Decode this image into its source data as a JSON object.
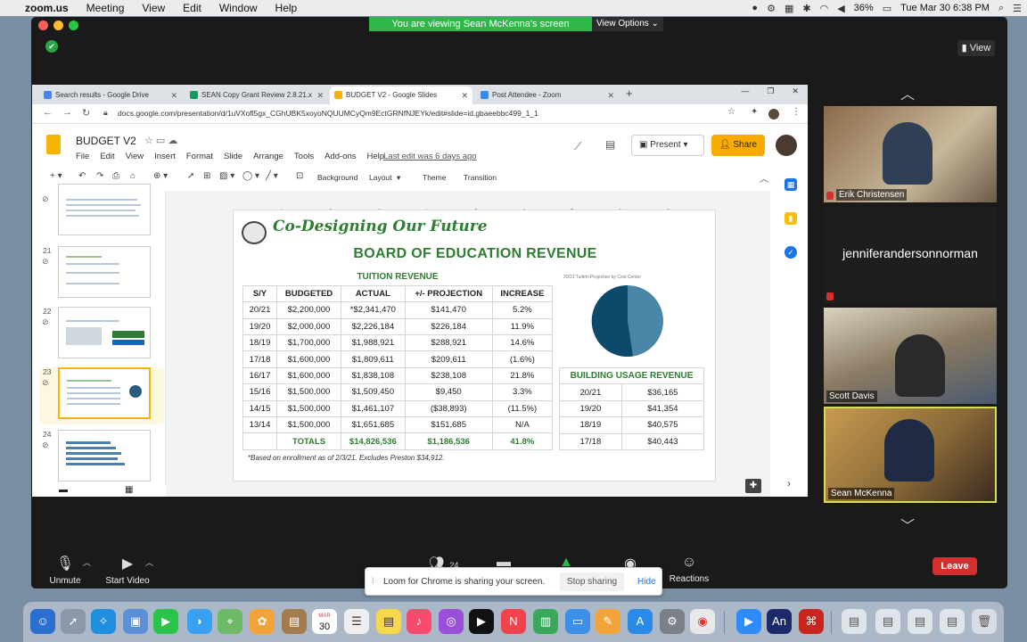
{
  "menubar": {
    "app_name": "zoom.us",
    "items": [
      "Meeting",
      "View",
      "Edit",
      "Window",
      "Help"
    ],
    "battery": "36%",
    "datetime": "Tue Mar 30  6:38 PM"
  },
  "zoom": {
    "viewing_banner": "You are viewing Sean McKenna's screen",
    "view_options": "View Options ⌄",
    "view_button": "View",
    "toolbar": {
      "unmute": "Unmute",
      "start_video": "Start Video",
      "participants_count": "24",
      "reactions": "Reactions",
      "leave": "Leave"
    }
  },
  "chrome": {
    "tabs": [
      {
        "label": "Search results - Google Drive",
        "color": "#4285f4"
      },
      {
        "label": "SEAN Copy Grant Review 2.8.21.x",
        "color": "#0f9d58"
      },
      {
        "label": "BUDGET V2 - Google Slides",
        "color": "#f4b400"
      },
      {
        "label": "Post Attendee - Zoom",
        "color": "#2d8cff"
      }
    ],
    "url": "docs.google.com/presentation/d/1uVXofl5gx_CGhUBK5xoyoNQUUMCyQm9EctGRNfNJEYk/edit#slide=id.gbaeebbc499_1_1"
  },
  "slides": {
    "doc_title": "BUDGET V2",
    "menu": [
      "File",
      "Edit",
      "View",
      "Insert",
      "Format",
      "Slide",
      "Arrange",
      "Tools",
      "Add-ons",
      "Help"
    ],
    "last_edit": "Last edit was 6 days ago",
    "present": "Present",
    "share": "Share",
    "toolbar": {
      "background": "Background",
      "layout": "Layout",
      "theme": "Theme",
      "transition": "Transition"
    },
    "thumb_numbers": [
      "21",
      "22",
      "23",
      "24"
    ],
    "ruler_ticks": [
      "1",
      "2",
      "3",
      "4",
      "5",
      "6",
      "7",
      "8",
      "9"
    ]
  },
  "slide": {
    "tagline": "Co-Designing Our Future",
    "title": "BOARD OF EDUCATION REVENUE",
    "tuition_caption": "TUITION REVENUE",
    "tuition_headers": [
      "S/Y",
      "BUDGETED",
      "ACTUAL",
      "+/- PROJECTION",
      "INCREASE"
    ],
    "tuition_rows": [
      [
        "20/21",
        "$2,200,000",
        "*$2,341,470",
        "$141,470",
        "5.2%"
      ],
      [
        "19/20",
        "$2,000,000",
        "$2,226,184",
        "$226,184",
        "11.9%"
      ],
      [
        "18/19",
        "$1,700,000",
        "$1,988,921",
        "$288,921",
        "14.6%"
      ],
      [
        "17/18",
        "$1,600,000",
        "$1,809,611",
        "$209,611",
        "(1.6%)"
      ],
      [
        "16/17",
        "$1,600,000",
        "$1,838,108",
        "$238,108",
        "21.8%"
      ],
      [
        "15/16",
        "$1,500,000",
        "$1,509,450",
        "$9,450",
        "3.3%"
      ],
      [
        "14/15",
        "$1,500,000",
        "$1,461,107",
        "($38,893)",
        "(11.5%)"
      ],
      [
        "13/14",
        "$1,500,000",
        "$1,651,685",
        "$151,685",
        "N/A"
      ]
    ],
    "totals": [
      "TOTALS",
      "$14,826,536",
      "$1,186,536",
      "41.8%"
    ],
    "note": "*Based on enrollment as of 2/3/21. Excludes Preston $34,912.",
    "pie_caption": "20/21 Tuition Projection by Cost Center",
    "building_caption": "BUILDING USAGE REVENUE",
    "building_rows": [
      [
        "20/21",
        "$36,165"
      ],
      [
        "19/20",
        "$41,354"
      ],
      [
        "18/19",
        "$40,575"
      ],
      [
        "17/18",
        "$40,443"
      ]
    ]
  },
  "participants": [
    {
      "name": "Erik Christensen",
      "muted": true
    },
    {
      "name": "jenniferandersonnorman",
      "muted": true
    },
    {
      "name": "Scott Davis",
      "muted": false
    },
    {
      "name": "Sean McKenna",
      "muted": false
    }
  ],
  "loom": {
    "message": "Loom for Chrome is sharing your screen.",
    "stop": "Stop sharing",
    "hide": "Hide"
  },
  "dock": {
    "calendar_month": "MAR",
    "calendar_day": "30"
  }
}
